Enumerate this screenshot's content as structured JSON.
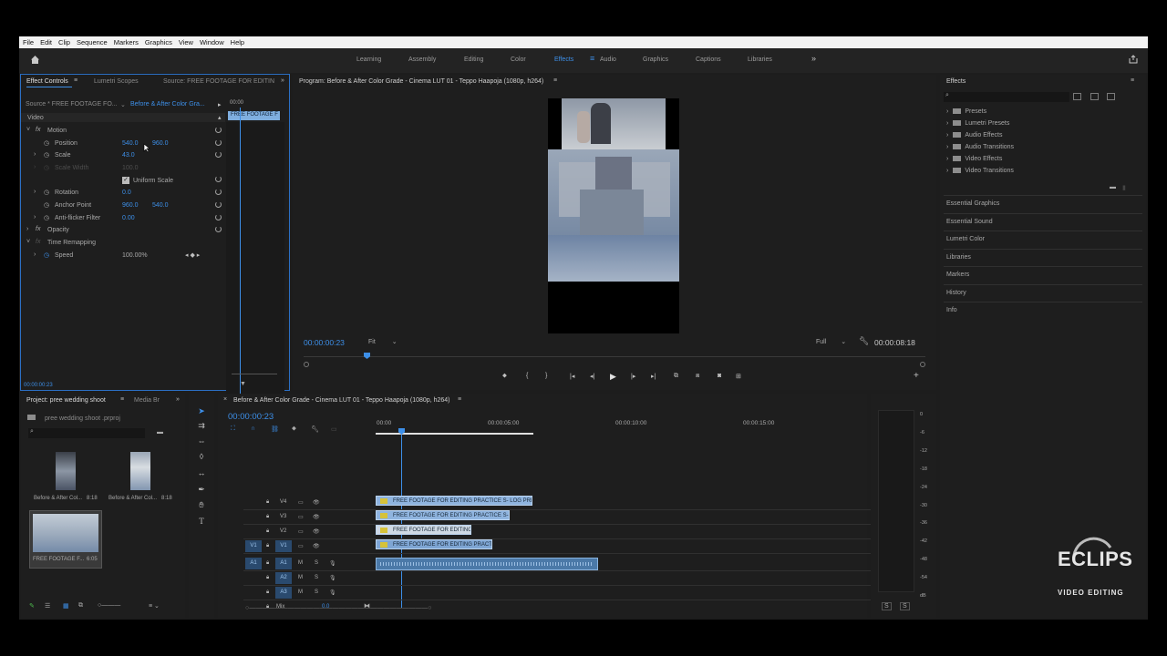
{
  "menu": [
    "File",
    "Edit",
    "Clip",
    "Sequence",
    "Markers",
    "Graphics",
    "View",
    "Window",
    "Help"
  ],
  "workspaces": [
    "Learning",
    "Assembly",
    "Editing",
    "Color",
    "Effects",
    "Audio",
    "Graphics",
    "Captions",
    "Libraries"
  ],
  "active_workspace": "Effects",
  "effect_controls": {
    "tabs": [
      "Effect Controls",
      "Lumetri Scopes",
      "Source: FREE FOOTAGE FOR EDITIN"
    ],
    "source_label": "Source * FREE FOOTAGE FO...",
    "sequence_label": "Before & After Color Gra...",
    "timecode_head": "00:00",
    "clip_label": "FREE FOOTAGE F",
    "section_video": "Video",
    "motion": "Motion",
    "position_label": "Position",
    "position_x": "540.0",
    "position_y": "960.0",
    "scale_label": "Scale",
    "scale_val": "43.0",
    "scale_width_label": "Scale Width",
    "scale_width_val": "100.0",
    "uniform_scale": "Uniform Scale",
    "rotation_label": "Rotation",
    "rotation_val": "0.0",
    "anchor_label": "Anchor Point",
    "anchor_x": "960.0",
    "anchor_y": "540.0",
    "antiflicker_label": "Anti-flicker Filter",
    "antiflicker_val": "0.00",
    "opacity": "Opacity",
    "time_remap": "Time Remapping",
    "speed_label": "Speed",
    "speed_val": "100.00%",
    "footer_time": "00:00:00:23"
  },
  "program": {
    "title": "Program: Before & After Color Grade - Cinema LUT 01 - Teppo Haapoja (1080p, h264)",
    "timecode": "00:00:00:23",
    "fit": "Fit",
    "quality": "Full",
    "duration": "00:00:08:18"
  },
  "effects_panel": {
    "title": "Effects",
    "tree": [
      "Presets",
      "Lumetri Presets",
      "Audio Effects",
      "Audio Transitions",
      "Video Effects",
      "Video Transitions"
    ],
    "sections": [
      "Essential Graphics",
      "Essential Sound",
      "Lumetri Color",
      "Libraries",
      "Markers",
      "History",
      "Info"
    ]
  },
  "project": {
    "tabs": [
      "Project: pree wedding shoot",
      "Media Br"
    ],
    "file": "pree wedding shoot .prproj",
    "items": [
      {
        "name": "Before & After Col...",
        "dur": "8:18"
      },
      {
        "name": "Before & After Col...",
        "dur": "8:18"
      },
      {
        "name": "FREE FOOTAGE F...",
        "dur": "6:05"
      }
    ]
  },
  "timeline": {
    "title": "Before & After Color Grade - Cinema LUT 01 - Teppo Haapoja (1080p, h264)",
    "timecode": "00:00:00:23",
    "ruler": [
      "00:00",
      "00:00:05:00",
      "00:00:10:00",
      "00:00:15:00"
    ],
    "tracks": [
      "V4",
      "V3",
      "V2",
      "V1",
      "A1",
      "A2",
      "A3"
    ],
    "mix_label": "Mix",
    "mix_val": "0.0",
    "clips": [
      "FREE FOOTAGE FOR EDITING PRACTICE  S- LOG PRE- W",
      "FREE FOOTAGE FOR EDITING PRACTICE  S- LO",
      "FREE FOOTAGE FOR EDITING P",
      "FREE FOOTAGE FOR EDITING PRACTICE"
    ]
  },
  "meter": {
    "scale": [
      "0",
      "-6",
      "-12",
      "-18",
      "-24",
      "-30",
      "-36",
      "-42",
      "-48",
      "-54",
      "dB"
    ],
    "solo": [
      "S",
      "S"
    ]
  },
  "watermark": {
    "brand": "ECLIPS",
    "sub": "VIDEO EDITING"
  }
}
